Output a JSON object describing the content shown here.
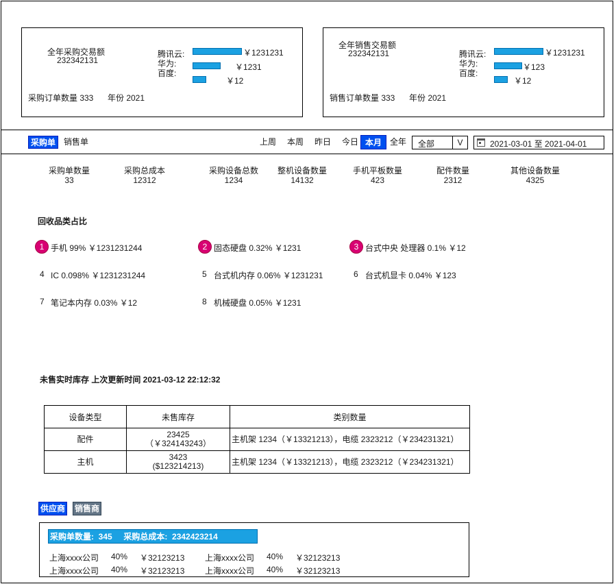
{
  "purchase_card": {
    "title": "全年采购交易额",
    "amount": "232342131",
    "bars": [
      {
        "label": "腾讯云:",
        "value": "￥1231231"
      },
      {
        "label": "华为:",
        "value": "￥1231"
      },
      {
        "label": "百度:",
        "value": "￥12"
      }
    ],
    "orders": "采购订单数量 333",
    "year": "年份 2021"
  },
  "sales_card": {
    "title": "全年销售交易额",
    "amount": "232342131",
    "bars": [
      {
        "label": "腾讯云:",
        "value": "￥1231231"
      },
      {
        "label": "华为:",
        "value": "￥123"
      },
      {
        "label": "百度:",
        "value": "￥12"
      }
    ],
    "orders": "销售订单数量 333",
    "year": "年份 2021"
  },
  "tabs": {
    "purchase": "采购单",
    "sales": "销售单"
  },
  "periods": [
    "上周",
    "本周",
    "昨日",
    "今日",
    "本月",
    "全年"
  ],
  "active_period": "本月",
  "filter": {
    "value": "全部",
    "arrow": "V"
  },
  "date_range": "2021-03-01 至 2021-04-01",
  "stats": [
    {
      "label": "采购单数量",
      "value": "33"
    },
    {
      "label": "采购总成本",
      "value": "12312"
    },
    {
      "label": "采购设备总数",
      "value": "1234"
    },
    {
      "label": "整机设备数量",
      "value": "14132"
    },
    {
      "label": "手机平板数量",
      "value": "423"
    },
    {
      "label": "配件数量",
      "value": "2312"
    },
    {
      "label": "其他设备数量",
      "value": "4325"
    }
  ],
  "categories_title": "回收品类占比",
  "categories": [
    {
      "rank": "1",
      "text": "手机   99%   ￥1231231244"
    },
    {
      "rank": "2",
      "text": "固态硬盘   0.32%   ￥1231"
    },
    {
      "rank": "3",
      "text": "台式中央 处理器   0.1%   ￥12"
    },
    {
      "rank": "4",
      "text": "IC   0.098%   ￥1231231244"
    },
    {
      "rank": "5",
      "text": "台式机内存   0.06%   ￥1231231"
    },
    {
      "rank": "6",
      "text": "台式机显卡   0.04%   ￥123"
    },
    {
      "rank": "7",
      "text": "笔记本内存   0.03%   ￥12"
    },
    {
      "rank": "8",
      "text": "机械硬盘   0.05%   ￥1231"
    }
  ],
  "inventory_title": "未售实时库存 上次更新时间 2021-03-12 22:12:32",
  "inventory": {
    "headers": [
      "设备类型",
      "未售库存",
      "类别数量"
    ],
    "rows": [
      {
        "type": "配件",
        "stock": "23425",
        "stock_value": "（￥324143243）",
        "detail": "主机架 1234（￥13321213），电缆 2323212（￥234231321）"
      },
      {
        "type": "主机",
        "stock": "3423",
        "stock_value": "($123214213)",
        "detail": "主机架 1234（￥13321213），电缆 2323212（￥234231321）"
      }
    ]
  },
  "vendor_tabs": {
    "supplier": "供应商",
    "seller": "销售商"
  },
  "vendor_summary": "采购单数量:  345     采购总成本:  2342423214",
  "vendors": [
    {
      "name": "上海xxxx公司",
      "pct": "40%",
      "amount": "￥32123213"
    },
    {
      "name": "上海xxxx公司",
      "pct": "40%",
      "amount": "￥32123213"
    },
    {
      "name": "上海xxxx公司",
      "pct": "40%",
      "amount": "￥32123213"
    },
    {
      "name": "上海xxxx公司",
      "pct": "40%",
      "amount": "￥32123213"
    }
  ],
  "colors": {
    "accent": "#0050ef",
    "bar": "#1ba1e2",
    "rank_badge": "#d80073",
    "seller_tab": "#647687"
  }
}
